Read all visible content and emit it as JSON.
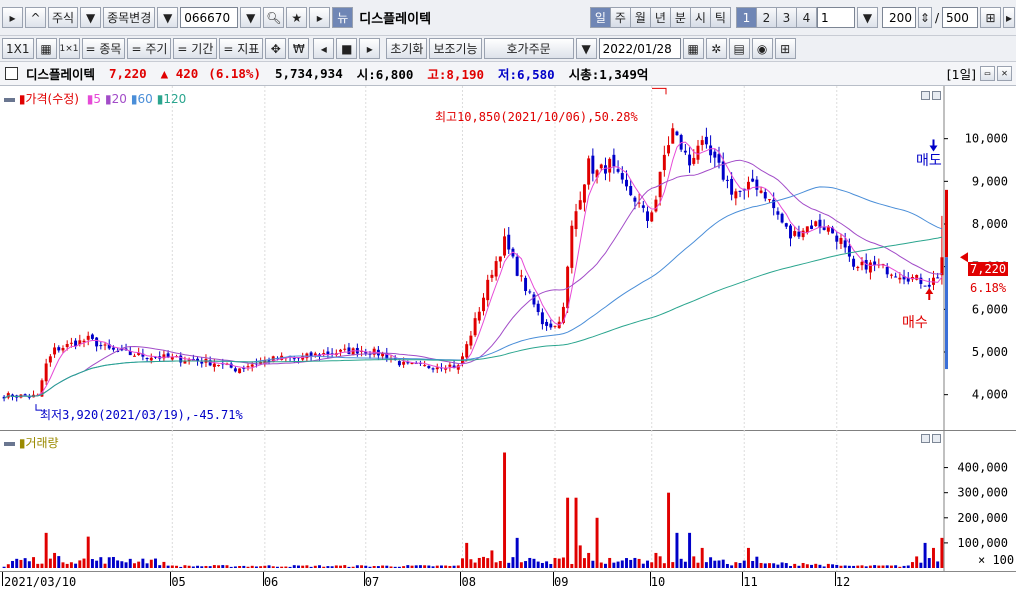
{
  "toolbar": {
    "market": "주식",
    "change_label": "종목변경",
    "code": "066670",
    "name_chip": "뉴",
    "stock_name": "디스플레이텍",
    "periods": [
      "일",
      "주",
      "월",
      "년",
      "분",
      "시",
      "틱"
    ],
    "active_period": "일",
    "counts": [
      "1",
      "2",
      "3",
      "4"
    ],
    "active_count": "1",
    "interval_value": "1",
    "display_count": "200",
    "separator": "/",
    "total_count": "500",
    "layout_label": "1X1",
    "item_btn": "= 종목",
    "cycle_btn": "= 주기",
    "range_btn": "= 기간",
    "indicator_btn": "= 지표",
    "reset_btn": "초기화",
    "aux_btn": "보조기능",
    "order_btn": "호가주문",
    "date_value": "2022/01/28"
  },
  "info": {
    "name": "디스플레이텍",
    "price": "7,220",
    "change": "▲ 420",
    "change_pct": "(6.18%)",
    "volume": "5,734,934",
    "open_label": "시:6,800",
    "high_label": "고:8,190",
    "low_label": "저:6,580",
    "mcap_label": "시총:1,349억",
    "period_label": "[1일]"
  },
  "legend": {
    "price_label": "가격(수정)",
    "ma": [
      {
        "name": "5",
        "color": "#e64ad7"
      },
      {
        "name": "20",
        "color": "#a24cc8"
      },
      {
        "name": "60",
        "color": "#4a8ed8"
      },
      {
        "name": "120",
        "color": "#2aa58e"
      }
    ],
    "volume_label": "거래량"
  },
  "colors": {
    "up": "#e00000",
    "down": "#0000c8",
    "ma5": "#e64ad7",
    "ma20": "#a24cc8",
    "ma60": "#4a8ed8",
    "ma120": "#2aa58e",
    "volume_title": "#9a8a00"
  },
  "annotations": {
    "high": "최고10,850(2021/10/06),50.28%",
    "low": "최저3,920(2021/03/19),-45.71%",
    "sell": "매도",
    "buy": "매수",
    "current_price": "7,220",
    "current_pct": "6.18%",
    "volume_unit": "× 100"
  },
  "chart_data": [
    {
      "type": "candlestick",
      "ylim": [
        3500,
        11000
      ],
      "yticks": [
        "4,000",
        "5,000",
        "6,000",
        "7,000",
        "8,000",
        "9,000",
        "10,000"
      ],
      "ytick_values": [
        4000,
        5000,
        6000,
        7000,
        8000,
        9000,
        10000
      ],
      "x_labels": [
        "2021/03/10",
        "05",
        "06",
        "07",
        "08",
        "09",
        "10",
        "11",
        "12"
      ],
      "x_label_index": [
        0,
        40,
        62,
        86,
        109,
        131,
        154,
        176,
        198
      ],
      "close_anchors": [
        [
          0,
          3980
        ],
        [
          8,
          3960
        ],
        [
          10,
          4700
        ],
        [
          12,
          5050
        ],
        [
          15,
          5150
        ],
        [
          20,
          5300
        ],
        [
          25,
          5050
        ],
        [
          30,
          4950
        ],
        [
          35,
          4900
        ],
        [
          40,
          4850
        ],
        [
          45,
          4800
        ],
        [
          50,
          4750
        ],
        [
          55,
          4600
        ],
        [
          60,
          4750
        ],
        [
          65,
          4850
        ],
        [
          70,
          4850
        ],
        [
          75,
          4950
        ],
        [
          80,
          5000
        ],
        [
          85,
          5050
        ],
        [
          90,
          4950
        ],
        [
          95,
          4700
        ],
        [
          100,
          4650
        ],
        [
          105,
          4700
        ],
        [
          108,
          4650
        ],
        [
          110,
          5150
        ],
        [
          113,
          6000
        ],
        [
          116,
          6900
        ],
        [
          119,
          7600
        ],
        [
          122,
          6900
        ],
        [
          125,
          6300
        ],
        [
          128,
          5700
        ],
        [
          131,
          5600
        ],
        [
          133,
          6000
        ],
        [
          135,
          7900
        ],
        [
          137,
          8700
        ],
        [
          139,
          9400
        ],
        [
          141,
          9200
        ],
        [
          144,
          9400
        ],
        [
          147,
          8900
        ],
        [
          150,
          8600
        ],
        [
          153,
          8100
        ],
        [
          155,
          8600
        ],
        [
          157,
          9600
        ],
        [
          159,
          10200
        ],
        [
          161,
          9800
        ],
        [
          163,
          9400
        ],
        [
          165,
          9900
        ],
        [
          167,
          9700
        ],
        [
          170,
          9300
        ],
        [
          173,
          8800
        ],
        [
          176,
          8700
        ],
        [
          178,
          9000
        ],
        [
          181,
          8700
        ],
        [
          184,
          8200
        ],
        [
          187,
          7700
        ],
        [
          190,
          7900
        ],
        [
          193,
          8000
        ],
        [
          196,
          7900
        ],
        [
          199,
          7600
        ],
        [
          202,
          6900
        ],
        [
          205,
          7050
        ],
        [
          208,
          7000
        ],
        [
          211,
          6900
        ],
        [
          214,
          6800
        ],
        [
          217,
          6700
        ],
        [
          220,
          6600
        ],
        [
          222,
          6800
        ],
        [
          223,
          7220
        ]
      ],
      "volume_anchors": [
        [
          0,
          5
        ],
        [
          10,
          140
        ],
        [
          12,
          60
        ],
        [
          20,
          125
        ],
        [
          40,
          10
        ],
        [
          108,
          10
        ],
        [
          110,
          100
        ],
        [
          113,
          40
        ],
        [
          116,
          70
        ],
        [
          119,
          460
        ],
        [
          122,
          120
        ],
        [
          125,
          40
        ],
        [
          128,
          20
        ],
        [
          131,
          40
        ],
        [
          134,
          280
        ],
        [
          136,
          280
        ],
        [
          137,
          90
        ],
        [
          139,
          60
        ],
        [
          141,
          200
        ],
        [
          144,
          40
        ],
        [
          147,
          30
        ],
        [
          150,
          40
        ],
        [
          155,
          60
        ],
        [
          158,
          300
        ],
        [
          160,
          140
        ],
        [
          163,
          140
        ],
        [
          166,
          80
        ],
        [
          170,
          30
        ],
        [
          175,
          20
        ],
        [
          177,
          80
        ],
        [
          180,
          20
        ],
        [
          190,
          20
        ],
        [
          200,
          10
        ],
        [
          215,
          10
        ],
        [
          219,
          100
        ],
        [
          221,
          80
        ],
        [
          223,
          120
        ]
      ],
      "volume_yticks": [
        "100,000",
        "200,000",
        "300,000",
        "400,000"
      ],
      "volume_ytick_values": [
        100,
        200,
        300,
        400
      ]
    }
  ]
}
